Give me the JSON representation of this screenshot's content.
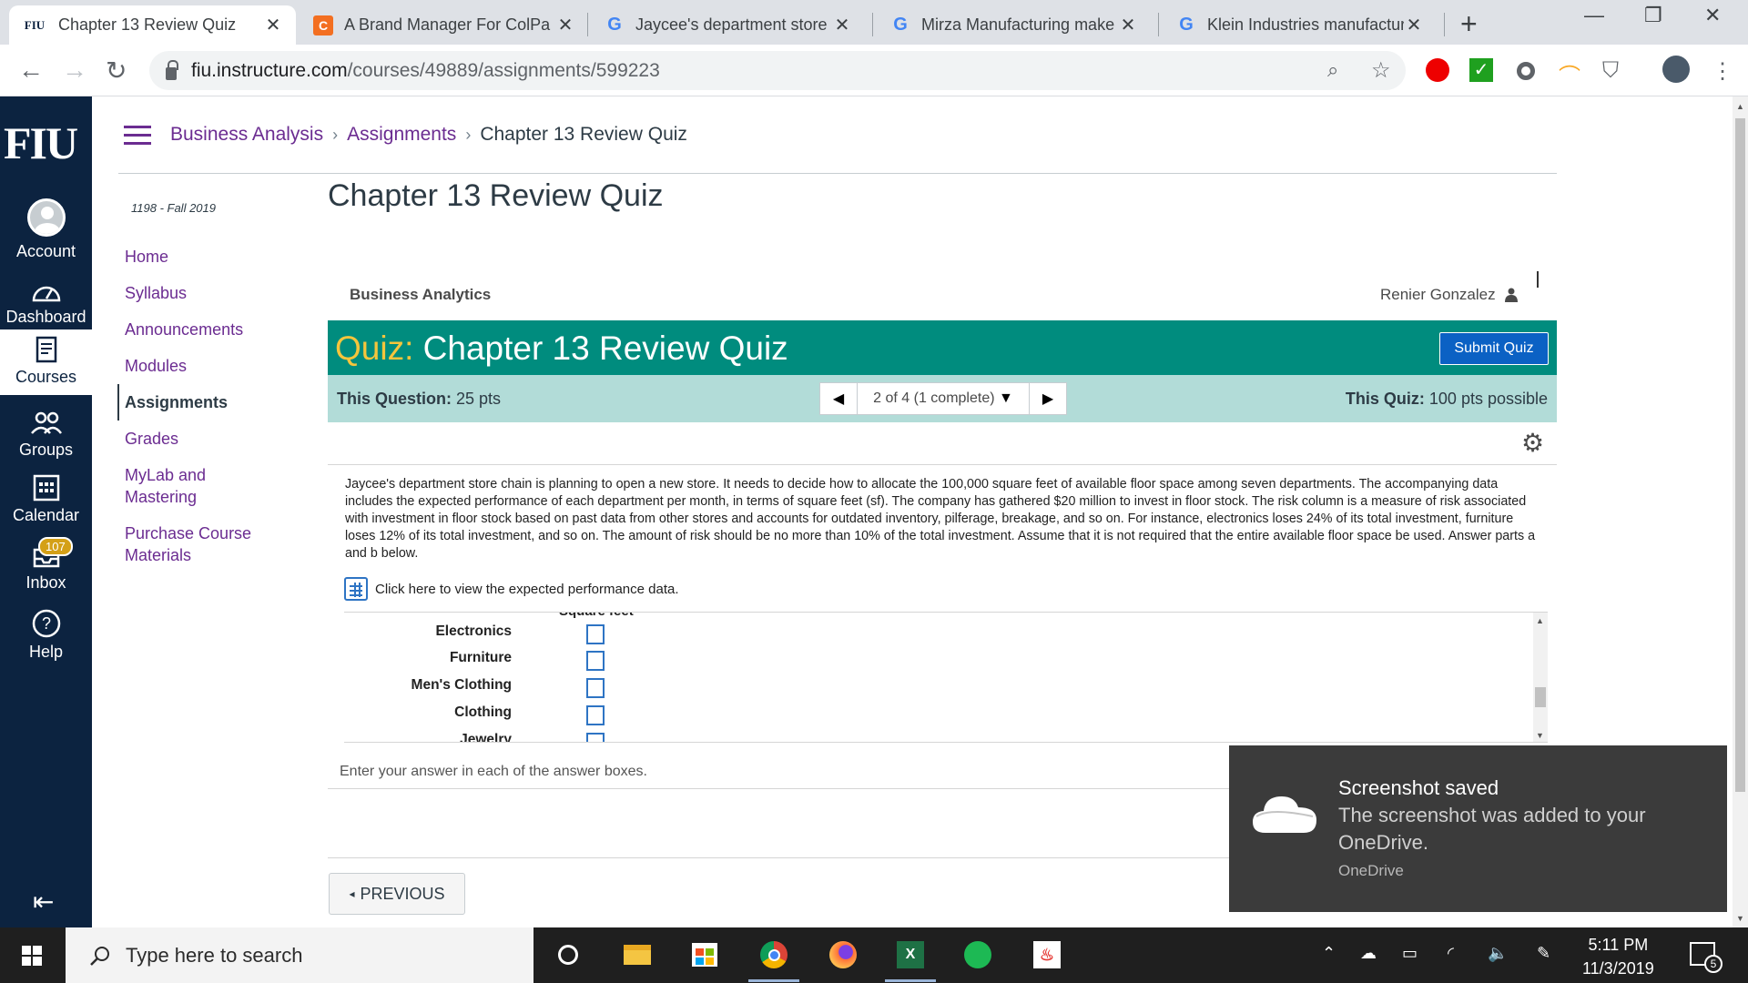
{
  "browser": {
    "tabs": [
      {
        "title": "Chapter 13 Review Quiz",
        "favicon": "FIU"
      },
      {
        "title": "A Brand Manager For ColPa",
        "favicon": "C"
      },
      {
        "title": "Jaycee's department store c",
        "favicon": "G"
      },
      {
        "title": "Mirza Manufacturing make",
        "favicon": "G"
      },
      {
        "title": "Klein Industries manufactur",
        "favicon": "G"
      }
    ],
    "new_tab": "+",
    "url_host": "fiu.instructure.com",
    "url_path": "/courses/49889/assignments/599223"
  },
  "global_nav": {
    "logo": "FIU",
    "items": [
      {
        "label": "Account",
        "icon": "avatar-icon"
      },
      {
        "label": "Dashboard",
        "icon": "dashboard-icon"
      },
      {
        "label": "Courses",
        "icon": "courses-icon"
      },
      {
        "label": "Groups",
        "icon": "groups-icon"
      },
      {
        "label": "Calendar",
        "icon": "calendar-icon"
      },
      {
        "label": "Inbox",
        "icon": "inbox-icon",
        "badge": "107"
      },
      {
        "label": "Help",
        "icon": "help-icon"
      }
    ]
  },
  "breadcrumb": {
    "items": [
      "Business Analysis",
      "Assignments",
      "Chapter 13 Review Quiz"
    ]
  },
  "course_nav": {
    "term": "1198 - Fall 2019",
    "items": [
      "Home",
      "Syllabus",
      "Announcements",
      "Modules",
      "Assignments",
      "Grades",
      "MyLab and Mastering",
      "Purchase Course Materials"
    ],
    "active": "Assignments"
  },
  "page_title": "Chapter 13 Review Quiz",
  "quiz": {
    "course": "Business Analytics",
    "user": "Renier Gonzalez",
    "prefix": "Quiz:",
    "title": "Chapter 13 Review Quiz",
    "submit_label": "Submit Quiz",
    "this_question_label": "This Question:",
    "this_question_value": "25 pts",
    "pager_text": "2 of 4 (1 complete)",
    "this_quiz_label": "This Quiz:",
    "this_quiz_value": "100 pts possible",
    "question_text": "Jaycee's department store chain is planning to open a new store. It needs to decide how to allocate the 100,000 square feet of available floor space among seven departments. The accompanying data includes the expected performance of each department per month, in terms of square feet (sf). The company has gathered $20 million to invest in floor stock. The risk column is a measure of risk associated with investment in floor stock based on past data from other stores and accounts for outdated inventory, pilferage, breakage, and so on. For instance, electronics loses 24% of its total investment, furniture loses 12% of its total investment, and so on. The amount of risk should be no more than 10% of the total investment. Assume that it is not required that the entire available floor space be used. Answer parts a and b below.",
    "data_link": "Click here to view the expected performance data.",
    "column_header": "Square feet",
    "rows": [
      "Electronics",
      "Furniture",
      "Men's Clothing",
      "Clothing",
      "Jewelry"
    ],
    "instructions": "Enter your answer in each of the answer boxes.",
    "previous_label": "PREVIOUS"
  },
  "toast": {
    "title": "Screenshot saved",
    "body": "The screenshot was added to your OneDrive.",
    "source": "OneDrive"
  },
  "taskbar": {
    "search_placeholder": "Type here to search",
    "time": "5:11 PM",
    "date": "11/3/2019",
    "notifications": "5"
  }
}
